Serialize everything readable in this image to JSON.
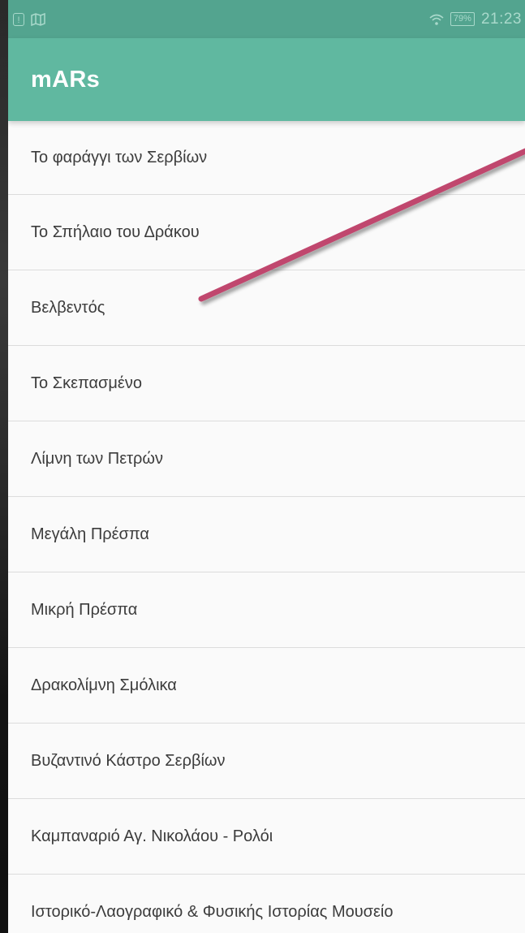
{
  "status_bar": {
    "battery": "79%",
    "time": "21:23",
    "icons": [
      "alert-icon",
      "map-icon",
      "wifi-icon",
      "battery-icon"
    ]
  },
  "app_bar": {
    "title": "mARs"
  },
  "list": {
    "items": [
      {
        "label": "Το φαράγγι των Σερβίων"
      },
      {
        "label": "Το Σπήλαιο του Δράκου"
      },
      {
        "label": "Βελβεντός"
      },
      {
        "label": "Το Σκεπασμένο"
      },
      {
        "label": "Λίμνη των Πετρών"
      },
      {
        "label": "Μεγάλη Πρέσπα"
      },
      {
        "label": "Μικρή Πρέσπα"
      },
      {
        "label": "Δρακολίμνη Σμόλικα"
      },
      {
        "label": "Βυζαντινό Κάστρο Σερβίων"
      },
      {
        "label": "Καμπαναριό Αγ. Νικολάου - Ρολόι"
      },
      {
        "label": "Ιστορικό-Λαογραφικό & Φυσικής Ιστορίας Μουσείο"
      }
    ]
  },
  "colors": {
    "status_bar": "#53a48f",
    "app_bar": "#60b8a0",
    "arrow": "#c0476e"
  }
}
